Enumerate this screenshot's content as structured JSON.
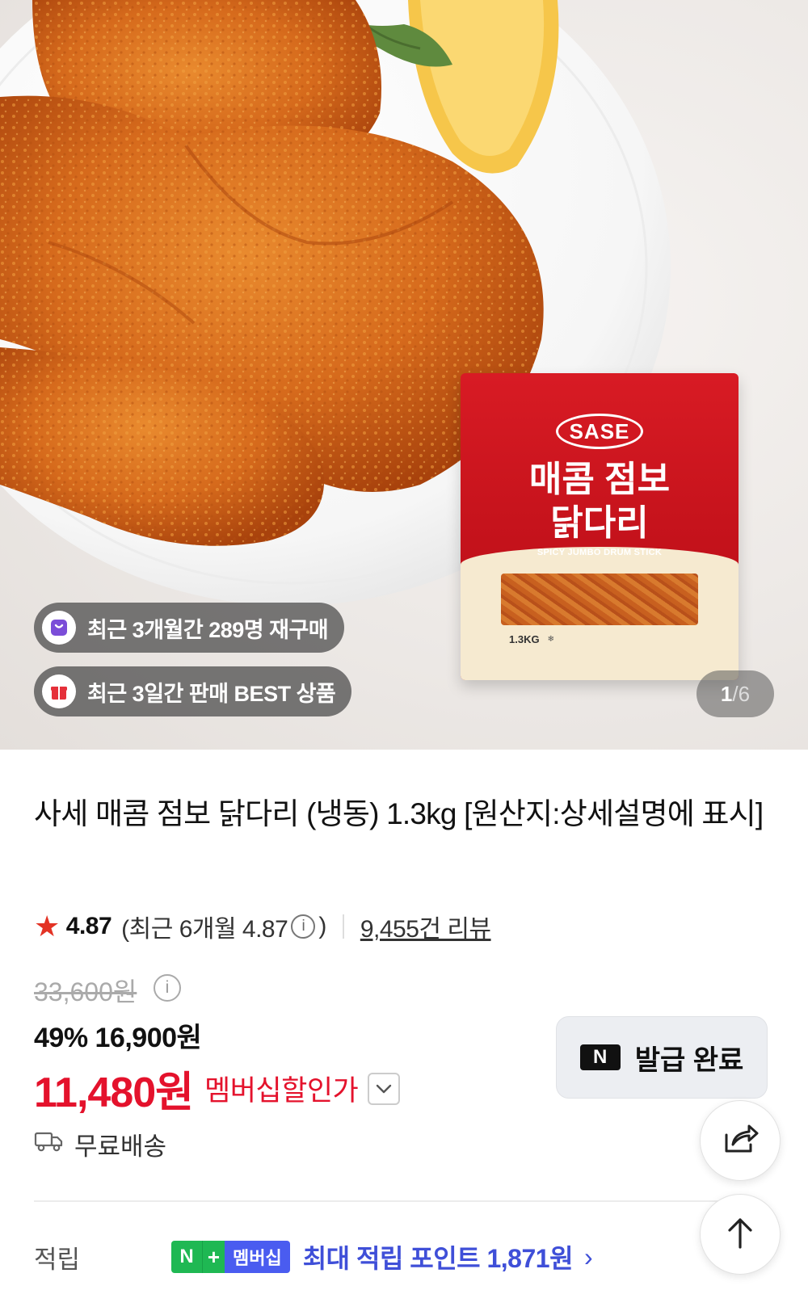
{
  "gallery": {
    "package": {
      "brand": "SASE",
      "title_line1": "매콤 점보",
      "title_line2": "닭다리",
      "subtitle": "SPICY JUMBO DRUM STICK",
      "weight": "1.3KG"
    },
    "badges": [
      {
        "text": "최근 3개월간 289명 재구매",
        "icon": "shopping-bag-icon"
      },
      {
        "text": "최근 3일간 판매 BEST 상품",
        "icon": "gift-icon"
      }
    ],
    "counter": {
      "current": "1",
      "separator": "/",
      "total": "6"
    }
  },
  "product": {
    "title": "사세 매콤 점보 닭다리 (냉동) 1.3kg [원산지:상세설명에 표시]",
    "rating": {
      "score": "4.87",
      "recent": "(최근 6개월 4.87",
      "recent_close": ")",
      "reviews": "9,455건 리뷰"
    },
    "original_price": "33,600원",
    "sale": {
      "percent": "49%",
      "price": "16,900원"
    },
    "member": {
      "price": "11,480원",
      "label": "멤버십할인가"
    },
    "coupon_button": "발급 완료",
    "shipping": "무료배송",
    "points": {
      "label": "적립",
      "badge_n": "N",
      "badge_plus": "+",
      "badge_member": "멤버십",
      "text": "최대 적립 포인트 1,871원",
      "chevron": "›"
    }
  },
  "colors": {
    "accent_red": "#e4122c",
    "points_blue": "#3f4fd8",
    "naver_green": "#1fb853",
    "star": "#e33325"
  }
}
